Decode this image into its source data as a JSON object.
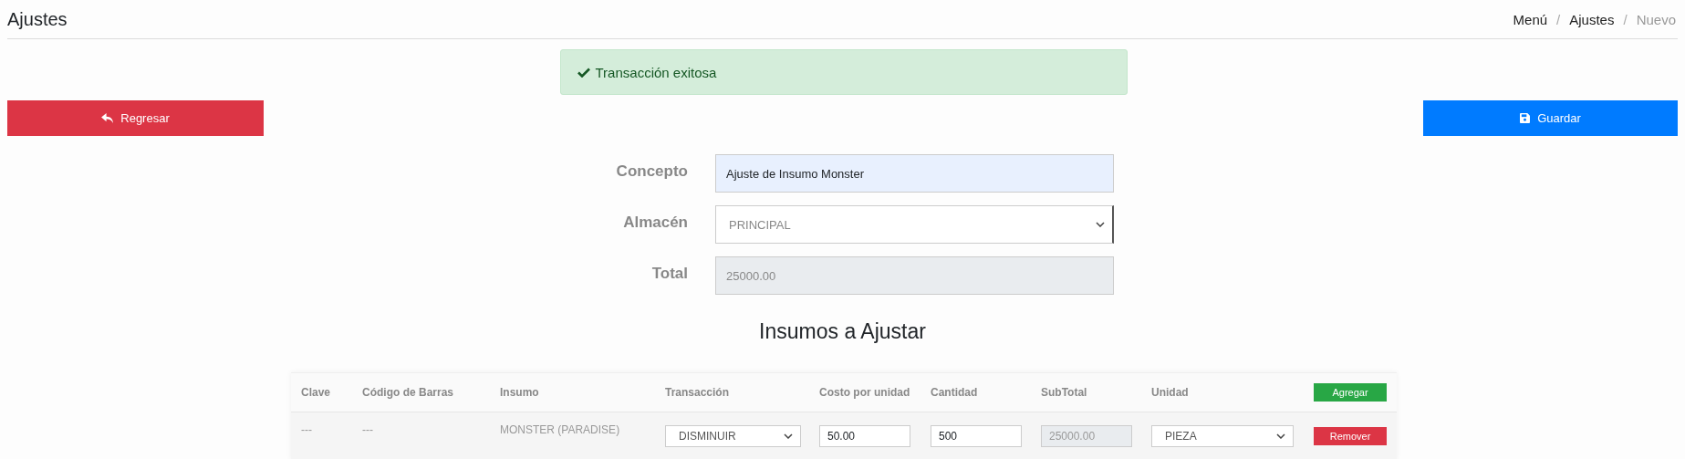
{
  "header": {
    "title": "Ajustes",
    "breadcrumb": [
      {
        "label": "Menú",
        "current": false
      },
      {
        "label": "Ajustes",
        "current": false
      },
      {
        "label": "Nuevo",
        "current": true
      }
    ],
    "separators": [
      "/",
      "/"
    ]
  },
  "alert": {
    "kind": "success",
    "text": "Transacción exitosa"
  },
  "back_button": {
    "label": "Regresar"
  },
  "save_button": {
    "label": "Guardar"
  },
  "form": {
    "fields": [
      {
        "label": "Concepto",
        "kind": "text",
        "value": "Ajuste de Insumo Monster"
      },
      {
        "label": "Almacén",
        "kind": "select",
        "value": "PRINCIPAL"
      },
      {
        "label": "Total",
        "kind": "readonly",
        "value": "25000.00"
      }
    ]
  },
  "table": {
    "title": "Insumos a Ajustar",
    "columns": [
      "Clave",
      "Código de Barras",
      "Insumo",
      "Transacción",
      "Costo por unidad",
      "Cantidad",
      "SubTotal",
      "Unidad"
    ],
    "add_button": "Agregar",
    "rows": [
      {
        "clave": "---",
        "codigo": "---",
        "insumo": "MONSTER (PARADISE)",
        "transaccion": "DISMINUIR",
        "costo": "50.00",
        "cantidad": "500",
        "subtotal": "25000.00",
        "unidad": "PIEZA",
        "remove_button": "Remover"
      }
    ]
  }
}
